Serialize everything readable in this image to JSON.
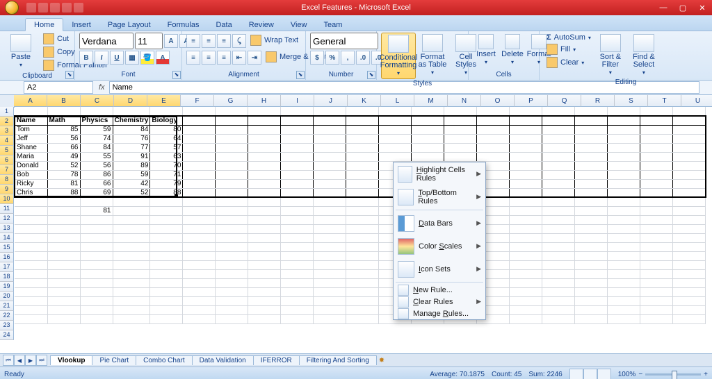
{
  "window": {
    "title": "Excel Features - Microsoft Excel"
  },
  "tabs": [
    "Home",
    "Insert",
    "Page Layout",
    "Formulas",
    "Data",
    "Review",
    "View",
    "Team"
  ],
  "active_tab": "Home",
  "ribbon": {
    "clipboard": {
      "label": "Clipboard",
      "paste": "Paste",
      "cut": "Cut",
      "copy": "Copy",
      "format_painter": "Format Painter"
    },
    "font": {
      "label": "Font",
      "name": "Verdana",
      "size": "11"
    },
    "alignment": {
      "label": "Alignment",
      "wrap": "Wrap Text",
      "merge": "Merge & Center"
    },
    "number": {
      "label": "Number",
      "format": "General"
    },
    "styles": {
      "label": "Styles",
      "cond": "Conditional\nFormatting",
      "table": "Format\nas Table",
      "cell": "Cell\nStyles"
    },
    "cells": {
      "label": "Cells",
      "insert": "Insert",
      "delete": "Delete",
      "format": "Format"
    },
    "editing": {
      "label": "Editing",
      "autosum": "AutoSum",
      "fill": "Fill",
      "clear": "Clear",
      "sort": "Sort &\nFilter",
      "find": "Find &\nSelect"
    }
  },
  "name_box": "A2",
  "formula": "Name",
  "columns": [
    "A",
    "B",
    "C",
    "D",
    "E",
    "F",
    "G",
    "H",
    "I",
    "J",
    "K",
    "L",
    "M",
    "N",
    "O",
    "P",
    "Q",
    "R",
    "S",
    "T",
    "U"
  ],
  "row_count": 24,
  "selected_rows": [
    2,
    3,
    4,
    5,
    6,
    7,
    8,
    9,
    10
  ],
  "selected_cols": [
    0,
    1,
    2,
    3,
    4
  ],
  "table_headers": [
    "Name",
    "Math",
    "Physics",
    "Chemistry",
    "Biology"
  ],
  "table_rows": [
    [
      "Tom",
      85,
      59,
      84,
      80
    ],
    [
      "Jeff",
      56,
      74,
      76,
      64
    ],
    [
      "Shane",
      66,
      84,
      77,
      57
    ],
    [
      "Maria",
      49,
      55,
      91,
      63
    ],
    [
      "Donald",
      52,
      56,
      89,
      70
    ],
    [
      "Bob",
      78,
      86,
      59,
      71
    ],
    [
      "Ricky",
      81,
      66,
      42,
      79
    ],
    [
      "Chris",
      88,
      69,
      52,
      88
    ]
  ],
  "extra_cell": {
    "row": 12,
    "col": 3,
    "value": 81
  },
  "cf_menu": {
    "highlight": "Highlight Cells Rules",
    "topbottom": "Top/Bottom Rules",
    "databars": "Data Bars",
    "colorscales": "Color Scales",
    "iconsets": "Icon Sets",
    "newrule": "New Rule...",
    "clear": "Clear Rules",
    "manage": "Manage Rules..."
  },
  "sheet_tabs": [
    "Vlookup",
    "Pie Chart",
    "Combo Chart",
    "Data Validation",
    "IFERROR",
    "Filtering And Sorting"
  ],
  "active_sheet": "Vlookup",
  "status": {
    "ready": "Ready",
    "avg": "Average: 70.1875",
    "count": "Count: 45",
    "sum": "Sum: 2246",
    "zoom": "100%"
  },
  "chart_data": {
    "type": "table",
    "columns": [
      "Name",
      "Math",
      "Physics",
      "Chemistry",
      "Biology"
    ],
    "rows": [
      [
        "Tom",
        85,
        59,
        84,
        80
      ],
      [
        "Jeff",
        56,
        74,
        76,
        64
      ],
      [
        "Shane",
        66,
        84,
        77,
        57
      ],
      [
        "Maria",
        49,
        55,
        91,
        63
      ],
      [
        "Donald",
        52,
        56,
        89,
        70
      ],
      [
        "Bob",
        78,
        86,
        59,
        71
      ],
      [
        "Ricky",
        81,
        66,
        42,
        79
      ],
      [
        "Chris",
        88,
        69,
        52,
        88
      ]
    ]
  }
}
